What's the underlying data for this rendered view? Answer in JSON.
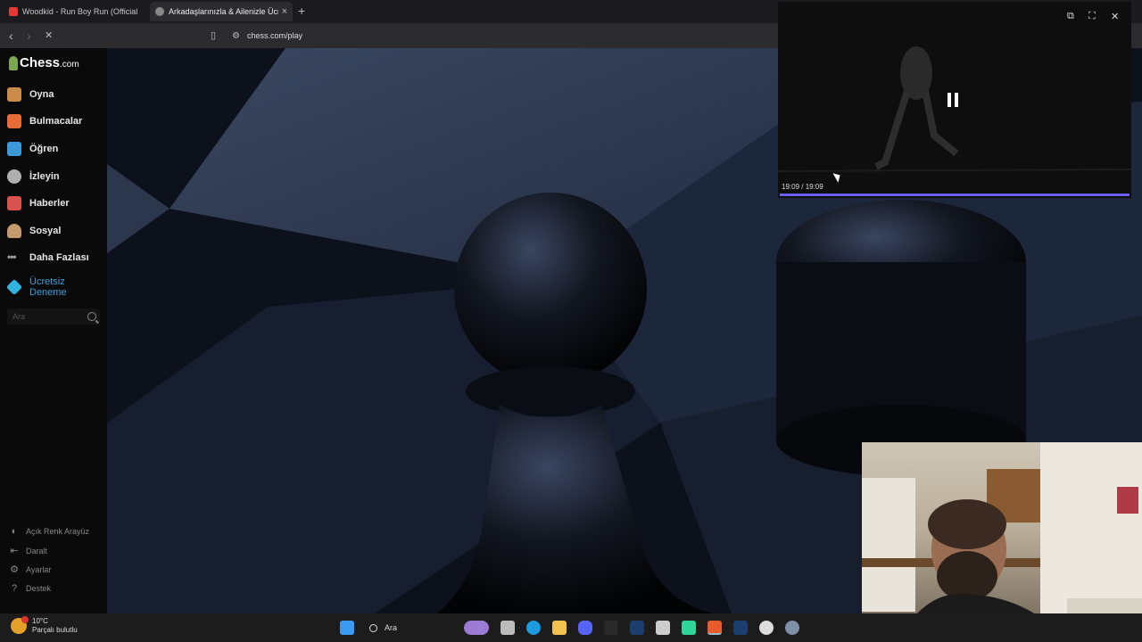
{
  "browser": {
    "tabs": [
      {
        "title": "Woodkid - Run Boy Run (Official",
        "favicon_color": "#e53935"
      },
      {
        "title": "Arkadaşlarınızla & Ailenizle Ücret",
        "favicon_color": "#aaaaaa",
        "active": true
      }
    ],
    "new_tab_symbol": "+",
    "close_symbol": "×",
    "url": "chess.com/play"
  },
  "sidebar": {
    "logo_text": "Chess",
    "logo_domain": ".com",
    "nav": [
      {
        "label": "Oyna",
        "icon": "pawn-hand-icon",
        "color": "#c98b4a"
      },
      {
        "label": "Bulmacalar",
        "icon": "puzzle-icon",
        "color": "#e46b34"
      },
      {
        "label": "Öğren",
        "icon": "learn-cube-icon",
        "color": "#3d9ad9"
      },
      {
        "label": "İzleyin",
        "icon": "binoculars-icon",
        "color": "#b0b0b0"
      },
      {
        "label": "Haberler",
        "icon": "news-icon",
        "color": "#d9534f"
      },
      {
        "label": "Sosyal",
        "icon": "social-icon",
        "color": "#c49a6c"
      },
      {
        "label": "Daha Fazlası",
        "icon": "more-dots-icon",
        "color": "#9a9a9a"
      }
    ],
    "trial": {
      "line1": "Ücretsiz",
      "line2": "Deneme"
    },
    "search_placeholder": "Ara",
    "bottom": [
      {
        "label": "Açık Renk Arayüz",
        "icon": "contrast-icon"
      },
      {
        "label": "Daralt",
        "icon": "collapse-icon"
      },
      {
        "label": "Ayarlar",
        "icon": "gear-icon"
      },
      {
        "label": "Destek",
        "icon": "help-icon"
      }
    ]
  },
  "pip": {
    "time": "19:09 / 19:09",
    "progress": 1.0,
    "accent": "#6a5cff"
  },
  "taskbar": {
    "weather_temp": "10°C",
    "weather_desc": "Parçalı bulutlu",
    "search_label": "Ara"
  }
}
